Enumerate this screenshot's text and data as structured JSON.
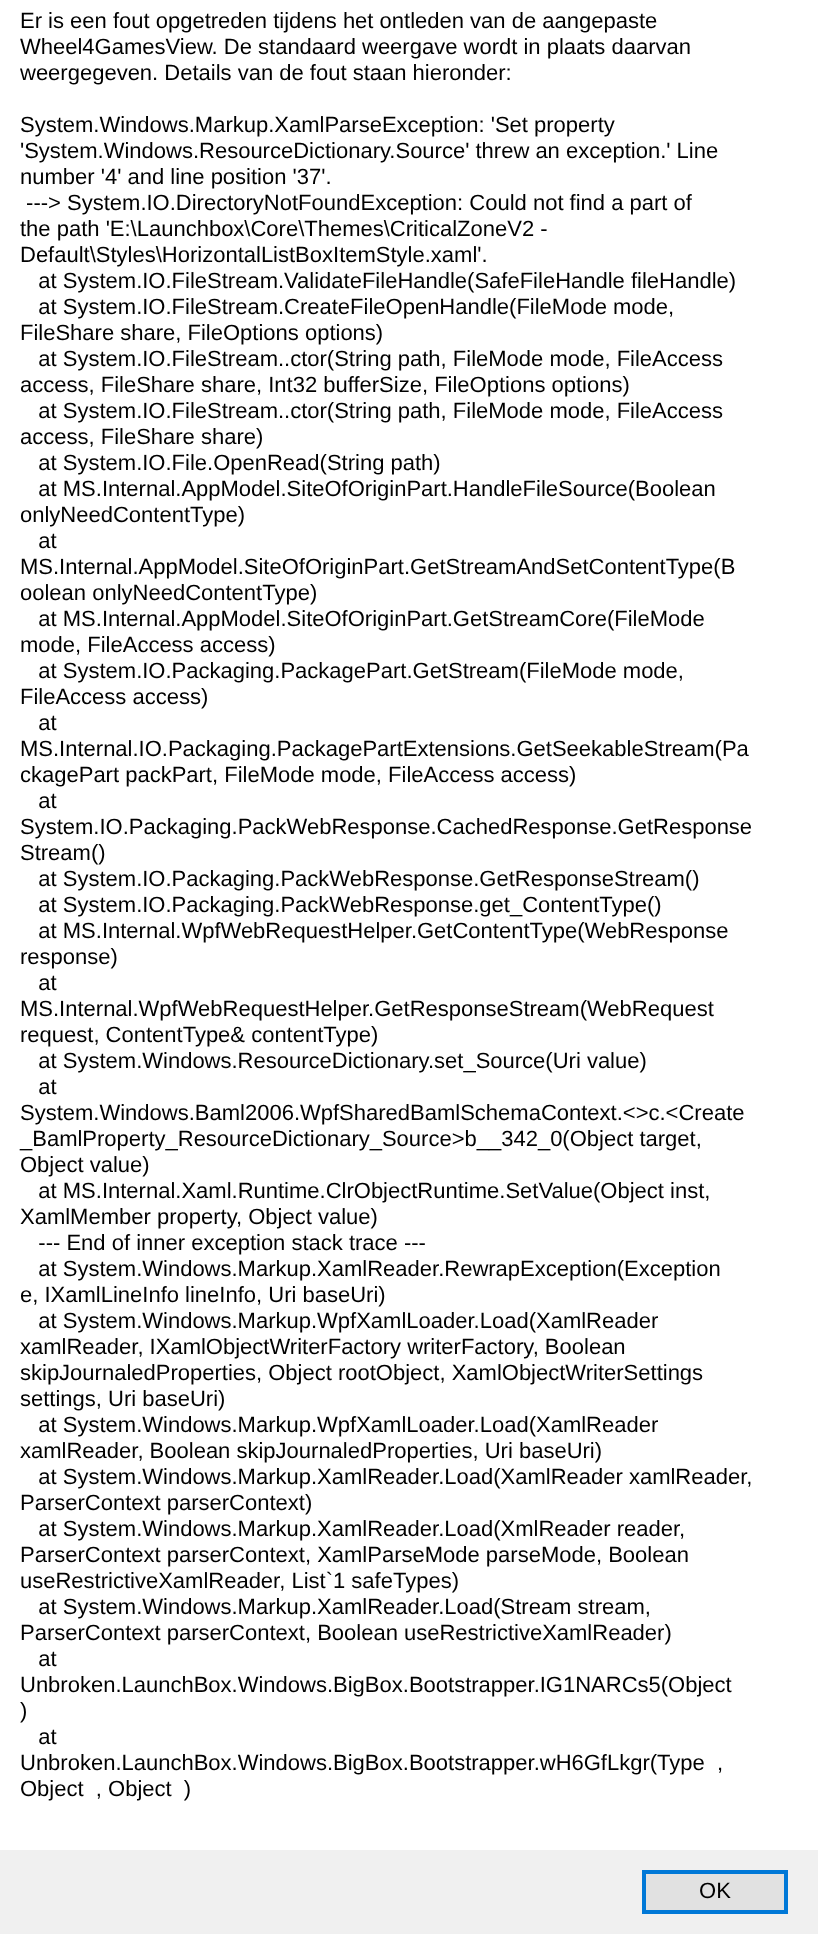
{
  "intro_lines": [
    "Er is een fout opgetreden tijdens het ontleden van de aangepaste",
    "Wheel4GamesView. De standaard weergave wordt in plaats daarvan",
    "weergegeven. Details van de fout staan hieronder:"
  ],
  "detail_lines": [
    "System.Windows.Markup.XamlParseException: 'Set property",
    "'System.Windows.ResourceDictionary.Source' threw an exception.' Line",
    "number '4' and line position '37'.",
    " ---> System.IO.DirectoryNotFoundException: Could not find a part of",
    "the path 'E:\\Launchbox\\Core\\Themes\\CriticalZoneV2 -",
    "Default\\Styles\\HorizontalListBoxItemStyle.xaml'.",
    "   at System.IO.FileStream.ValidateFileHandle(SafeFileHandle fileHandle)",
    "   at System.IO.FileStream.CreateFileOpenHandle(FileMode mode,",
    "FileShare share, FileOptions options)",
    "   at System.IO.FileStream..ctor(String path, FileMode mode, FileAccess",
    "access, FileShare share, Int32 bufferSize, FileOptions options)",
    "   at System.IO.FileStream..ctor(String path, FileMode mode, FileAccess",
    "access, FileShare share)",
    "   at System.IO.File.OpenRead(String path)",
    "   at MS.Internal.AppModel.SiteOfOriginPart.HandleFileSource(Boolean",
    "onlyNeedContentType)",
    "   at",
    "MS.Internal.AppModel.SiteOfOriginPart.GetStreamAndSetContentType(B",
    "oolean onlyNeedContentType)",
    "   at MS.Internal.AppModel.SiteOfOriginPart.GetStreamCore(FileMode",
    "mode, FileAccess access)",
    "   at System.IO.Packaging.PackagePart.GetStream(FileMode mode,",
    "FileAccess access)",
    "   at",
    "MS.Internal.IO.Packaging.PackagePartExtensions.GetSeekableStream(Pa",
    "ckagePart packPart, FileMode mode, FileAccess access)",
    "   at",
    "System.IO.Packaging.PackWebResponse.CachedResponse.GetResponse",
    "Stream()",
    "   at System.IO.Packaging.PackWebResponse.GetResponseStream()",
    "   at System.IO.Packaging.PackWebResponse.get_ContentType()",
    "   at MS.Internal.WpfWebRequestHelper.GetContentType(WebResponse",
    "response)",
    "   at",
    "MS.Internal.WpfWebRequestHelper.GetResponseStream(WebRequest",
    "request, ContentType& contentType)",
    "   at System.Windows.ResourceDictionary.set_Source(Uri value)",
    "   at",
    "System.Windows.Baml2006.WpfSharedBamlSchemaContext.<>c.<Create",
    "_BamlProperty_ResourceDictionary_Source>b__342_0(Object target,",
    "Object value)",
    "   at MS.Internal.Xaml.Runtime.ClrObjectRuntime.SetValue(Object inst,",
    "XamlMember property, Object value)",
    "   --- End of inner exception stack trace ---",
    "   at System.Windows.Markup.XamlReader.RewrapException(Exception",
    "e, IXamlLineInfo lineInfo, Uri baseUri)",
    "   at System.Windows.Markup.WpfXamlLoader.Load(XamlReader",
    "xamlReader, IXamlObjectWriterFactory writerFactory, Boolean",
    "skipJournaledProperties, Object rootObject, XamlObjectWriterSettings",
    "settings, Uri baseUri)",
    "   at System.Windows.Markup.WpfXamlLoader.Load(XamlReader",
    "xamlReader, Boolean skipJournaledProperties, Uri baseUri)",
    "   at System.Windows.Markup.XamlReader.Load(XamlReader xamlReader,",
    "ParserContext parserContext)",
    "   at System.Windows.Markup.XamlReader.Load(XmlReader reader,",
    "ParserContext parserContext, XamlParseMode parseMode, Boolean",
    "useRestrictiveXamlReader, List`1 safeTypes)",
    "   at System.Windows.Markup.XamlReader.Load(Stream stream,",
    "ParserContext parserContext, Boolean useRestrictiveXamlReader)",
    "   at",
    "Unbroken.LaunchBox.Windows.BigBox.Bootstrapper.IG1NARCs5(Object",
    ")",
    "   at",
    "Unbroken.LaunchBox.Windows.BigBox.Bootstrapper.wH6GfLkgr(Type  ,",
    "Object  , Object  )"
  ],
  "buttons": [
    "OK"
  ]
}
